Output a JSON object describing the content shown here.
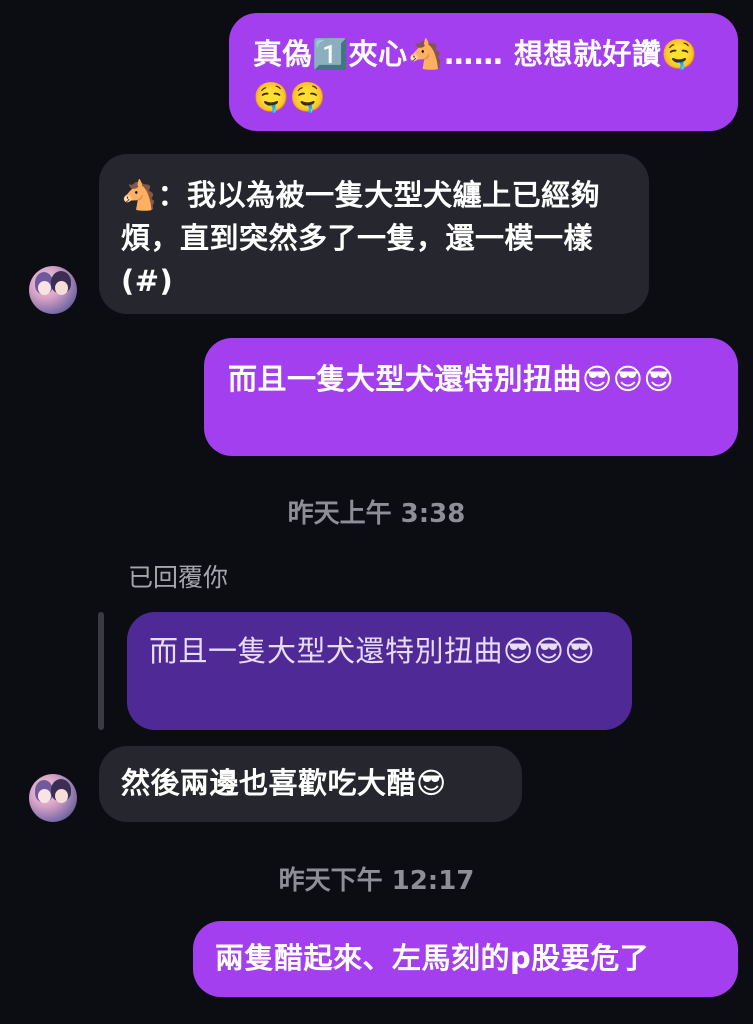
{
  "messages": [
    {
      "id": "m1",
      "direction": "sent",
      "text": "真偽1️⃣夾心🐴…… 想想就好讚🤤🤤🤤"
    },
    {
      "id": "m2",
      "direction": "received",
      "text": "🐴：我以為被一隻大型犬纏上已經夠煩，直到突然多了一隻，還一模一樣 (#)"
    },
    {
      "id": "m3",
      "direction": "sent",
      "text": "而且一隻大型犬還特別扭曲😎😎😎"
    },
    {
      "id": "m4",
      "direction": "received",
      "reply_label": "已回覆你",
      "quoted_text": "而且一隻大型犬還特別扭曲😎😎😎",
      "text": "然後兩邊也喜歡吃大醋😎"
    },
    {
      "id": "m5",
      "direction": "sent",
      "text": "兩隻醋起來、左馬刻的p股要危了"
    }
  ],
  "timestamps": {
    "t1": "昨天上午 3:38",
    "t2": "昨天下午 12:17"
  },
  "colors": {
    "background": "#0c0d12",
    "sent_bubble": "#a43ff0",
    "received_bubble": "#26272e",
    "reply_quote": "#4f2a96",
    "timestamp_text": "#8e8f96"
  },
  "icons": {
    "avatar": "avatar-illustration"
  }
}
